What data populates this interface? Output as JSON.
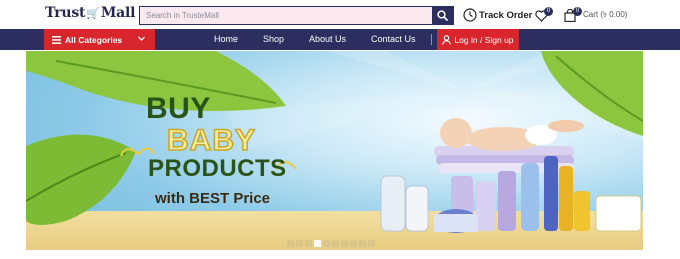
{
  "header": {
    "logo_left": "Trust",
    "logo_right": "Mall",
    "search_placeholder": "Search in TrusteMall",
    "track_order": "Track Order",
    "wishlist_count": "0",
    "cart_count": "0",
    "cart_label": "Cart (৳ 0.00)"
  },
  "nav": {
    "all_categories": "All Categories",
    "links": [
      "Home",
      "Shop",
      "About Us",
      "Contact Us"
    ],
    "login": "Log in / Sign up"
  },
  "banner": {
    "line1": "BUY",
    "line2": "BABY",
    "line3": "PRODUCTS",
    "line4": "with BEST Price",
    "slide_count": 10,
    "active_slide": 4
  },
  "colors": {
    "navy": "#2b2e5e",
    "red": "#d8262c",
    "pink": "#e0245e"
  }
}
